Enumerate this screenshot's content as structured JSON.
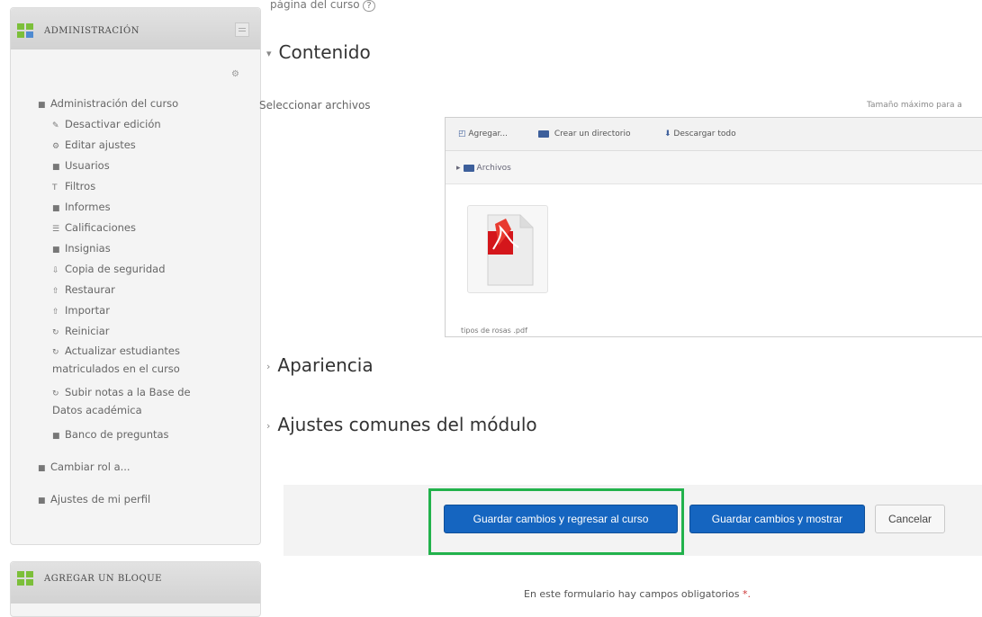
{
  "sidebar": {
    "admin_block_title": "ADMINISTRACIÓN",
    "add_block_title": "AGREGAR UN BLOQUE",
    "items": [
      {
        "label": "Administración del curso",
        "icon": "folder-icon"
      },
      {
        "label": "Desactivar edición",
        "icon": "pencil-icon"
      },
      {
        "label": "Editar ajustes",
        "icon": "gear-icon"
      },
      {
        "label": "Usuarios",
        "icon": "folder-icon"
      },
      {
        "label": "Filtros",
        "icon": "filter-icon"
      },
      {
        "label": "Informes",
        "icon": "folder-icon"
      },
      {
        "label": "Calificaciones",
        "icon": "grades-icon"
      },
      {
        "label": "Insignias",
        "icon": "folder-icon"
      },
      {
        "label": "Copia de seguridad",
        "icon": "backup-icon"
      },
      {
        "label": "Restaurar",
        "icon": "restore-icon"
      },
      {
        "label": "Importar",
        "icon": "import-icon"
      },
      {
        "label": "Reiniciar",
        "icon": "reset-icon"
      },
      {
        "label": "Actualizar estudiantes matriculados en el curso",
        "icon": "refresh-icon"
      },
      {
        "label": "Subir notas a la Base de Datos académica",
        "icon": "refresh-icon"
      },
      {
        "label": "Banco de preguntas",
        "icon": "folder-icon"
      },
      {
        "label": "Cambiar rol a...",
        "icon": "folder-icon"
      },
      {
        "label": "Ajustes de mi perfil",
        "icon": "folder-icon"
      }
    ]
  },
  "main": {
    "top_cut_text": "página del curso",
    "section_contenido": "Contenido",
    "select_files_label": "Seleccionar archivos",
    "max_size_text": "Tamaño máximo para a",
    "filepicker": {
      "add_label": "Agregar...",
      "create_dir_label": "Crear un directorio",
      "download_all_label": "Descargar todo",
      "path_label": "Archivos",
      "file_name": "tipos de rosas .pdf"
    },
    "section_apariencia": "Apariencia",
    "section_ajustes": "Ajustes comunes del módulo",
    "buttons": {
      "save_return": "Guardar cambios y regresar al curso",
      "save_show": "Guardar cambios y mostrar",
      "cancel": "Cancelar"
    },
    "required_note": "En este formulario hay campos obligatorios",
    "required_star": "*."
  },
  "colors": {
    "primary_button": "#1565c0",
    "highlight_box": "#22b24c",
    "pdf_red": "#d4161b"
  }
}
